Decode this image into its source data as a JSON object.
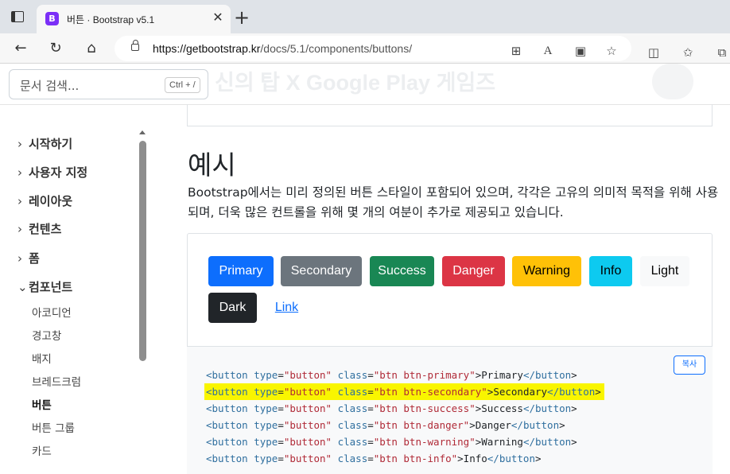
{
  "browser": {
    "tab_title": "버튼 · Bootstrap v5.1",
    "tab_favicon_letter": "B",
    "url_host": "https://getbootstrap.kr",
    "url_path": "/docs/5.1/components/buttons/"
  },
  "search": {
    "placeholder": "문서 검색...",
    "shortcut": "Ctrl + /"
  },
  "banner_ghost_text": "신의 탑 X Google Play 게임즈",
  "sidebar": {
    "groups": [
      {
        "label": "시작하기"
      },
      {
        "label": "사용자 지정"
      },
      {
        "label": "레이아웃"
      },
      {
        "label": "컨텐츠"
      },
      {
        "label": "폼"
      },
      {
        "label": "컴포넌트"
      }
    ],
    "items": [
      {
        "label": "아코디언"
      },
      {
        "label": "경고창"
      },
      {
        "label": "배지"
      },
      {
        "label": "브레드크럼"
      },
      {
        "label": "버튼"
      },
      {
        "label": "버튼 그룹"
      },
      {
        "label": "카드"
      }
    ]
  },
  "main": {
    "heading": "예시",
    "lead": "Bootstrap에서는 미리 정의된 버튼 스타일이 포함되어 있으며, 각각은 고유의 의미적 목적을 위해 사용되며, 더욱 많은 컨트롤을 위해 몇 개의 여분이 추가로 제공되고 있습니다.",
    "buttons": [
      {
        "label": "Primary",
        "bg": "#0d6efd",
        "color": "#ffffff"
      },
      {
        "label": "Secondary",
        "bg": "#6c757d",
        "color": "#ffffff"
      },
      {
        "label": "Success",
        "bg": "#198754",
        "color": "#ffffff"
      },
      {
        "label": "Danger",
        "bg": "#dc3545",
        "color": "#ffffff"
      },
      {
        "label": "Warning",
        "bg": "#ffc107",
        "color": "#000000"
      },
      {
        "label": "Info",
        "bg": "#0dcaf0",
        "color": "#000000"
      },
      {
        "label": "Light",
        "bg": "#f8f9fa",
        "color": "#000000"
      },
      {
        "label": "Dark",
        "bg": "#212529",
        "color": "#ffffff"
      },
      {
        "label": "Link",
        "bg": "transparent",
        "color": "#0d6efd"
      }
    ],
    "copy_label": "복사",
    "code_lines": [
      {
        "class": "btn btn-primary",
        "text": "Primary"
      },
      {
        "class": "btn btn-secondary",
        "text": "Secondary",
        "highlighted": true
      },
      {
        "class": "btn btn-success",
        "text": "Success"
      },
      {
        "class": "btn btn-danger",
        "text": "Danger"
      },
      {
        "class": "btn btn-warning",
        "text": "Warning"
      },
      {
        "class": "btn btn-info",
        "text": "Info"
      }
    ]
  }
}
